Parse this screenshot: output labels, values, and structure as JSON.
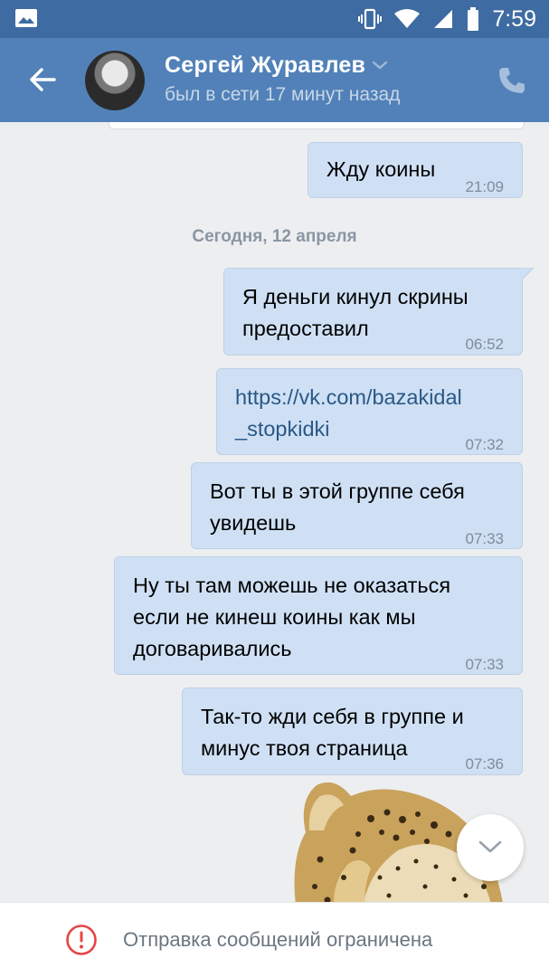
{
  "status_bar": {
    "time": "7:59"
  },
  "header": {
    "contact_name": "Сергей Журавлев",
    "contact_status": "был в сети 17 минут назад"
  },
  "messages": [
    {
      "text_lines": [
        "Жду коины"
      ],
      "time": "21:09"
    },
    {
      "text_lines": [
        "Я деньги кинул скрины",
        "предоставил"
      ],
      "time": "06:52"
    },
    {
      "text_lines": [
        "https://vk.com/bazakidal",
        "_stopkidki"
      ],
      "time": "07:32"
    },
    {
      "text_lines": [
        "Вот ты в этой группе себя",
        "увидешь"
      ],
      "time": "07:33"
    },
    {
      "text_lines": [
        "Ну ты там можешь не оказаться",
        "если не кинеш коины как мы",
        "договаривались"
      ],
      "time": "07:33"
    },
    {
      "text_lines": [
        "Так-то жди себя в группе и",
        "минус твоя страница"
      ],
      "time": "07:36"
    }
  ],
  "date_separator": "Сегодня, 12 апреля",
  "footer": {
    "restriction_text": "Отправка сообщений ограничена"
  },
  "icons": {
    "gallery": "gallery-icon",
    "vibrate": "vibrate-icon",
    "wifi": "wifi-icon",
    "signal": "signal-icon",
    "battery": "battery-icon",
    "back": "back-arrow-icon",
    "call": "phone-icon",
    "scroll": "chevron-down-icon",
    "warning": "warning-icon"
  },
  "colors": {
    "status_bar": "#3e6ba1",
    "header": "#5181b8",
    "bubble": "#cfe0f5",
    "link": "#2a5885",
    "warning": "#e64646"
  }
}
